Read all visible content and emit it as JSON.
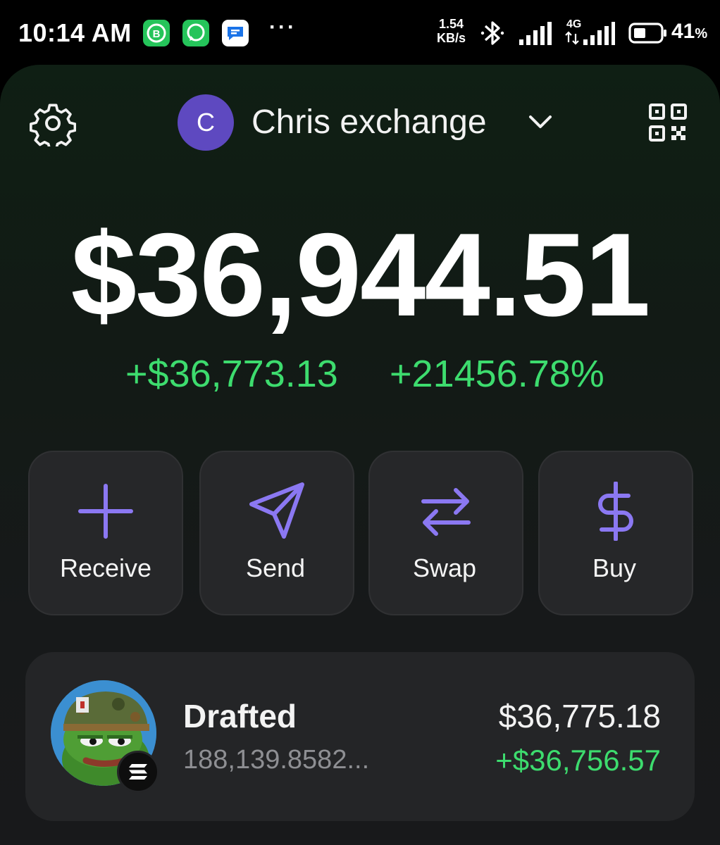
{
  "status_bar": {
    "time": "10:14 AM",
    "net_speed_value": "1.54",
    "net_speed_unit": "KB/s",
    "network_type": "4G",
    "battery_percent": "41",
    "battery_unit": "%",
    "apps": [
      "business-chat-icon",
      "whatsapp-icon",
      "messages-icon"
    ],
    "overflow": "···"
  },
  "header": {
    "account_initial": "C",
    "account_name": "Chris exchange",
    "account_color": "#5e49c0"
  },
  "balance": {
    "total": "$36,944.51",
    "change_usd": "+$36,773.13",
    "change_pct": "+21456.78%"
  },
  "actions": {
    "receive": "Receive",
    "send": "Send",
    "swap": "Swap",
    "buy": "Buy",
    "icon_color": "#8b78f2"
  },
  "tokens": [
    {
      "name": "Drafted",
      "amount": "188,139.8582...",
      "value": "$36,775.18",
      "change": "+$36,756.57",
      "chain": "solana-icon"
    }
  ],
  "colors": {
    "positive": "#3ddc6e",
    "card": "#262729"
  }
}
